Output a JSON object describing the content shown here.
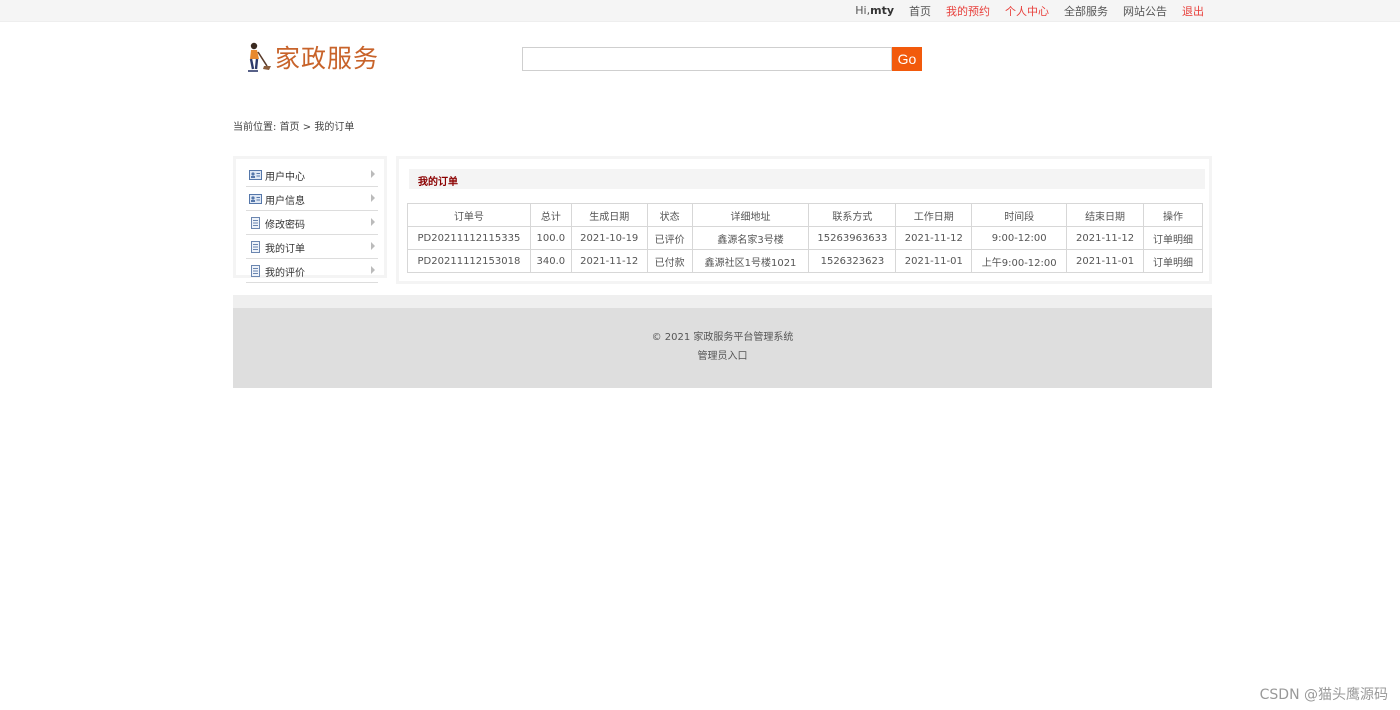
{
  "topbar": {
    "greeting_prefix": "Hi,",
    "username": "mty",
    "links": [
      {
        "label": "首页",
        "highlight": false
      },
      {
        "label": "我的预约",
        "highlight": true
      },
      {
        "label": "个人中心",
        "highlight": true
      },
      {
        "label": "全部服务",
        "highlight": false
      },
      {
        "label": "网站公告",
        "highlight": false
      },
      {
        "label": "退出",
        "highlight": true
      }
    ]
  },
  "header": {
    "logo_text": "家政服务",
    "search": {
      "value": "",
      "placeholder": "",
      "button_label": "Go"
    }
  },
  "breadcrumb": {
    "prefix": "当前位置:",
    "home": "首页",
    "separator": ">",
    "current": "我的订单"
  },
  "sidebar": {
    "items": [
      {
        "label": "用户中心",
        "icon": "user-card-icon"
      },
      {
        "label": "用户信息",
        "icon": "user-card-icon"
      },
      {
        "label": "修改密码",
        "icon": "document-icon"
      },
      {
        "label": "我的订单",
        "icon": "document-icon"
      },
      {
        "label": "我的评价",
        "icon": "document-icon"
      }
    ]
  },
  "main": {
    "title": "我的订单",
    "columns": [
      "订单号",
      "总计",
      "生成日期",
      "状态",
      "详细地址",
      "联系方式",
      "工作日期",
      "时间段",
      "结束日期",
      "操作"
    ],
    "rows": [
      [
        "PD20211112115335",
        "100.0",
        "2021-10-19",
        "已评价",
        "鑫源名家3号楼",
        "15263963633",
        "2021-11-12",
        "9:00-12:00",
        "2021-11-12",
        "订单明细"
      ],
      [
        "PD20211112153018",
        "340.0",
        "2021-11-12",
        "已付款",
        "鑫源社区1号楼1021",
        "1526323623",
        "2021-11-01",
        "上午9:00-12:00",
        "2021-11-01",
        "订单明细"
      ]
    ]
  },
  "footer": {
    "copyright_symbol": "©",
    "copyright": "2021 家政服务平台管理系统",
    "admin_link": "管理员入口"
  },
  "watermark": "CSDN @猫头鹰源码",
  "colors": {
    "accent": "#f25a0c",
    "logo": "#c8632a",
    "link_red": "#e8403c",
    "title_red": "#8b0000"
  }
}
